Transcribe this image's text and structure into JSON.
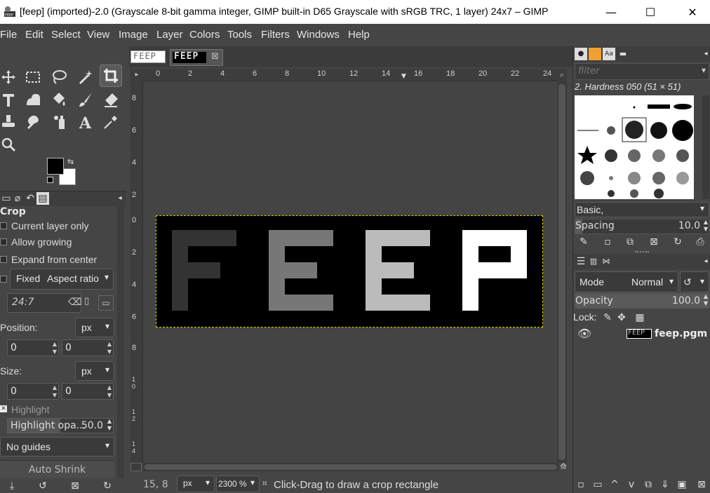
{
  "window": {
    "title": "[feep] (imported)-2.0 (Grayscale 8-bit gamma integer, GIMP built-in D65 Grayscale with sRGB TRC, 1 layer) 24x7 – GIMP",
    "minimize": "—",
    "maximize": "☐",
    "close": "✕",
    "app_icon": "gimp-icon"
  },
  "menubar": [
    "File",
    "Edit",
    "Select",
    "View",
    "Image",
    "Layer",
    "Colors",
    "Tools",
    "Filters",
    "Windows",
    "Help"
  ],
  "toolbox": {
    "tools": [
      "move-icon",
      "rect-select-icon",
      "lasso-icon",
      "fuzzy-select-icon",
      "crop-icon",
      "transform-icon",
      "warp-icon",
      "bucket-fill-icon",
      "paintbrush-icon",
      "eraser-icon",
      "clone-icon",
      "smudge-icon",
      "dodge-icon",
      "text-icon",
      "color-picker-icon",
      "zoom-icon"
    ],
    "fg_color": "#000000",
    "bg_color": "#ffffff"
  },
  "tool_options": {
    "title": "Crop",
    "current_layer_only": "Current layer only",
    "allow_growing": "Allow growing",
    "expand_from_center": "Expand from center",
    "fixed_label": "Fixed",
    "fixed_mode": "Aspect ratio",
    "ratio_value": "24:7",
    "position_label": "Position:",
    "position_unit": "px",
    "position_x": "0",
    "position_y": "0",
    "size_label": "Size:",
    "size_unit": "px",
    "size_w": "0",
    "size_h": "0",
    "highlight_label": "Highlight",
    "highlight_opacity_label": "Highlight opa...",
    "highlight_opacity_value": "50.0",
    "guides": "No guides",
    "auto_shrink": "Auto Shrink"
  },
  "image_window": {
    "tabs": [
      "FEEP",
      "FEEP"
    ],
    "tab_thumb_label": "FEEP",
    "ruler_h_ticks": [
      "0",
      "2",
      "4",
      "6",
      "8",
      "10",
      "12",
      "14",
      "16",
      "18",
      "20",
      "22",
      "24"
    ],
    "ruler_v_ticks": [
      "8",
      "6",
      "4",
      "2",
      "0",
      "2",
      "4",
      "6",
      "8",
      "10",
      "12",
      "14"
    ],
    "image_letters": [
      {
        "char": "F",
        "color": "#333333"
      },
      {
        "char": "E",
        "color": "#777777"
      },
      {
        "char": "E",
        "color": "#bbbbbb"
      },
      {
        "char": "P",
        "color": "#ffffff"
      }
    ]
  },
  "statusbar": {
    "coords": "15, 8",
    "unit": "px",
    "zoom": "2300 %",
    "message": "Click-Drag to draw a crop rectangle"
  },
  "brushes": {
    "filter_placeholder": "filter",
    "selected_brush": "2. Hardness 050 (51 × 51)",
    "preset": "Basic,",
    "spacing_label": "Spacing",
    "spacing_value": "10.0"
  },
  "layers": {
    "mode_label": "Mode",
    "mode_value": "Normal",
    "opacity_label": "Opacity",
    "opacity_value": "100.0",
    "lock_label": "Lock:",
    "layer_name": "feep.pgm",
    "layer_thumb_label": "FEEP"
  }
}
